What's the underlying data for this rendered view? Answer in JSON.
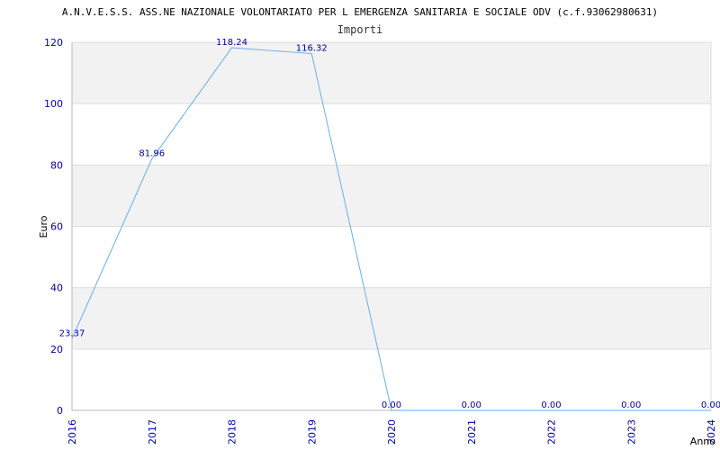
{
  "chart_data": {
    "type": "line",
    "title": "A.N.V.E.S.S. ASS.NE NAZIONALE VOLONTARIATO PER L EMERGENZA SANITARIA E SOCIALE ODV (c.f.93062980631)",
    "subtitle": "Importi",
    "xlabel": "Anno",
    "ylabel": "Euro",
    "categories": [
      "2016",
      "2017",
      "2018",
      "2019",
      "2020",
      "2021",
      "2022",
      "2023",
      "2024"
    ],
    "series": [
      {
        "values": [
          23.37,
          81.96,
          118.24,
          116.32,
          0,
          0,
          0,
          0,
          0
        ],
        "labels": [
          "23.37",
          "81.96",
          "118.24",
          "116.32",
          "0.00",
          "0.00",
          "0.00",
          "0.00",
          "0.00"
        ]
      }
    ],
    "ylim": [
      0,
      120
    ],
    "yticks": [
      0,
      20,
      40,
      60,
      80,
      100,
      120
    ],
    "grid": true,
    "legend": "none",
    "colors": {
      "line": "#6aaee8",
      "band": "#f2f2f2",
      "grid": "#dddddd",
      "tick_text": "#0000aa"
    }
  }
}
